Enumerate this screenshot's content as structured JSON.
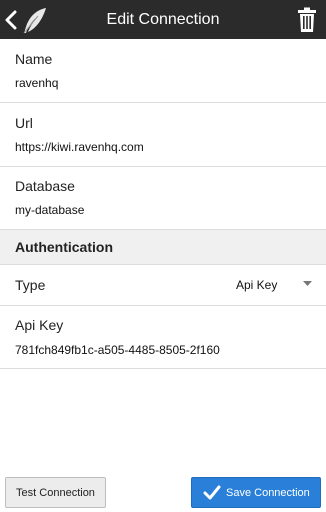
{
  "actionbar": {
    "title": "Edit Connection",
    "icons": {
      "back": "chevron-left-icon",
      "logo": "feather-icon",
      "delete": "trash-icon"
    }
  },
  "form": {
    "name": {
      "label": "Name",
      "value": "ravenhq"
    },
    "url": {
      "label": "Url",
      "value": "https://kiwi.ravenhq.com"
    },
    "database": {
      "label": "Database",
      "value": "my-database"
    },
    "auth_section": {
      "title": "Authentication"
    },
    "type": {
      "label": "Type",
      "selected": "Api Key"
    },
    "api_key": {
      "label": "Api Key",
      "value": "781fch849fb1c-a505-4485-8505-2f160"
    }
  },
  "buttons": {
    "test": "Test Connection",
    "save": "Save Connection"
  },
  "colors": {
    "actionbar": "#2b2b2b",
    "accent": "#2a80d8",
    "section_bg": "#f0f0f0"
  }
}
